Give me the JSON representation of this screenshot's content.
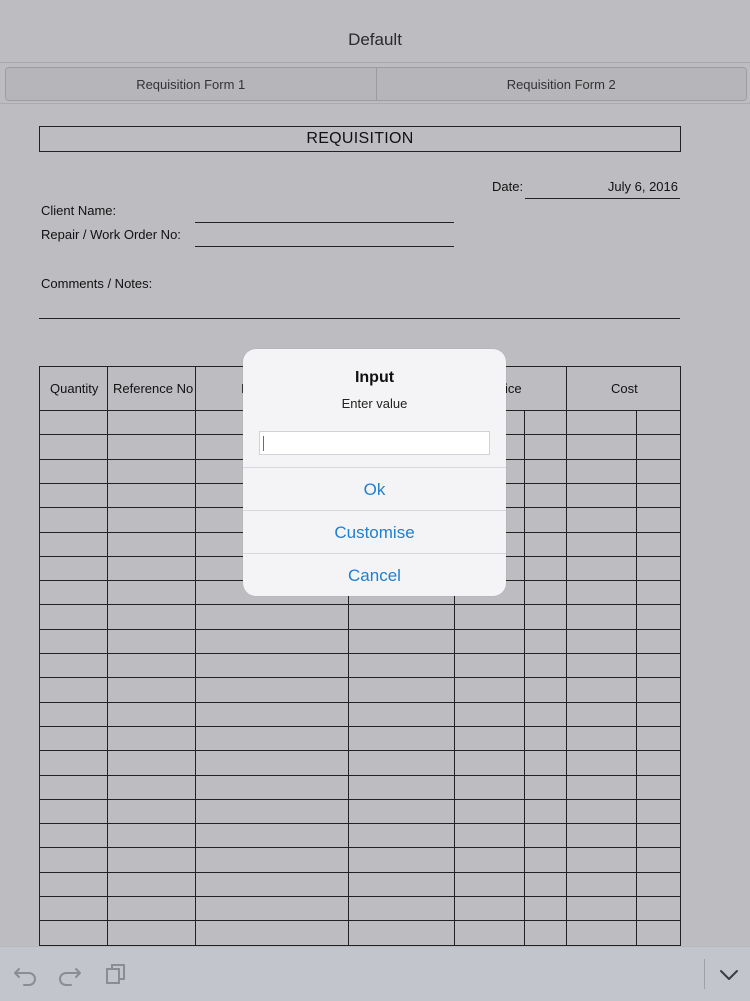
{
  "navbar": {
    "title": "Default"
  },
  "tabs": [
    {
      "label": "Requisition Form 1"
    },
    {
      "label": "Requisition Form 2"
    }
  ],
  "form": {
    "title": "REQUISITION",
    "date_label": "Date:",
    "date_value": "July 6, 2016",
    "client_name_label": "Client Name:",
    "work_order_label": "Repair / Work Order No:",
    "comments_label": "Comments / Notes:"
  },
  "table": {
    "headers": [
      "Quantity",
      "Reference No",
      "",
      "",
      "Price",
      "Cost"
    ],
    "visible_header_fragments": {
      "col3": "I",
      "price": "ice"
    },
    "row_count": 22
  },
  "dialog": {
    "title": "Input",
    "message": "Enter value",
    "input_value": "",
    "buttons": {
      "ok": "Ok",
      "customise": "Customise",
      "cancel": "Cancel"
    }
  },
  "toolbar": {
    "icons": [
      "undo-icon",
      "redo-icon",
      "copy-icon",
      "chevron-down-icon"
    ]
  },
  "colors": {
    "accent": "#1e7fd0",
    "background": "#bdbcc1",
    "toolbar": "#c3c5cd"
  }
}
